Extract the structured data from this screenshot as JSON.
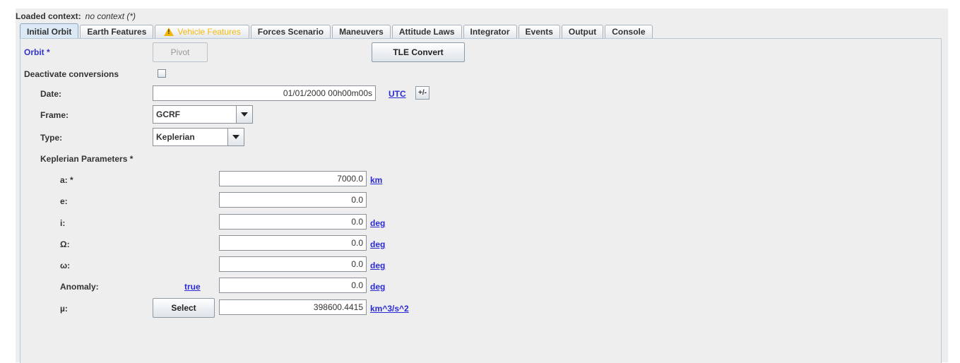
{
  "context": {
    "label": "Loaded context:",
    "value": "no context (*)"
  },
  "tabs": [
    {
      "label": "Initial Orbit"
    },
    {
      "label": "Earth Features"
    },
    {
      "label": "Vehicle Features"
    },
    {
      "label": "Forces Scenario"
    },
    {
      "label": "Maneuvers"
    },
    {
      "label": "Attitude Laws"
    },
    {
      "label": "Integrator"
    },
    {
      "label": "Events"
    },
    {
      "label": "Output"
    },
    {
      "label": "Console"
    }
  ],
  "orbit": {
    "label": "Orbit *",
    "pivot_button": "Pivot",
    "tle_button": "TLE Convert",
    "deactivate_label": "Deactivate conversions",
    "date": {
      "label": "Date:",
      "value": "01/01/2000 00h00m00s",
      "scale_link": "UTC",
      "pm_button": "+/-"
    },
    "frame": {
      "label": "Frame:",
      "value": "GCRF"
    },
    "type": {
      "label": "Type:",
      "value": "Keplerian"
    },
    "kep_title": "Keplerian Parameters *",
    "params": {
      "a": {
        "label": "a: *",
        "value": "7000.0",
        "unit": "km"
      },
      "e": {
        "label": "e:",
        "value": "0.0"
      },
      "i": {
        "label": "i:",
        "value": "0.0",
        "unit": "deg"
      },
      "raan": {
        "label": "Ω:",
        "value": "0.0",
        "unit": "deg"
      },
      "omega": {
        "label": "ω:",
        "value": "0.0",
        "unit": "deg"
      },
      "anomaly": {
        "label": "Anomaly:",
        "type_link": "true",
        "value": "0.0",
        "unit": "deg"
      },
      "mu": {
        "label": "µ:",
        "select_button": "Select",
        "value": "398600.4415",
        "unit": "km^3/s^2"
      }
    }
  },
  "colors": {
    "accent_link": "#2b2bd6",
    "warning": "#f5b90c",
    "panel_bg": "#eeeeee"
  }
}
